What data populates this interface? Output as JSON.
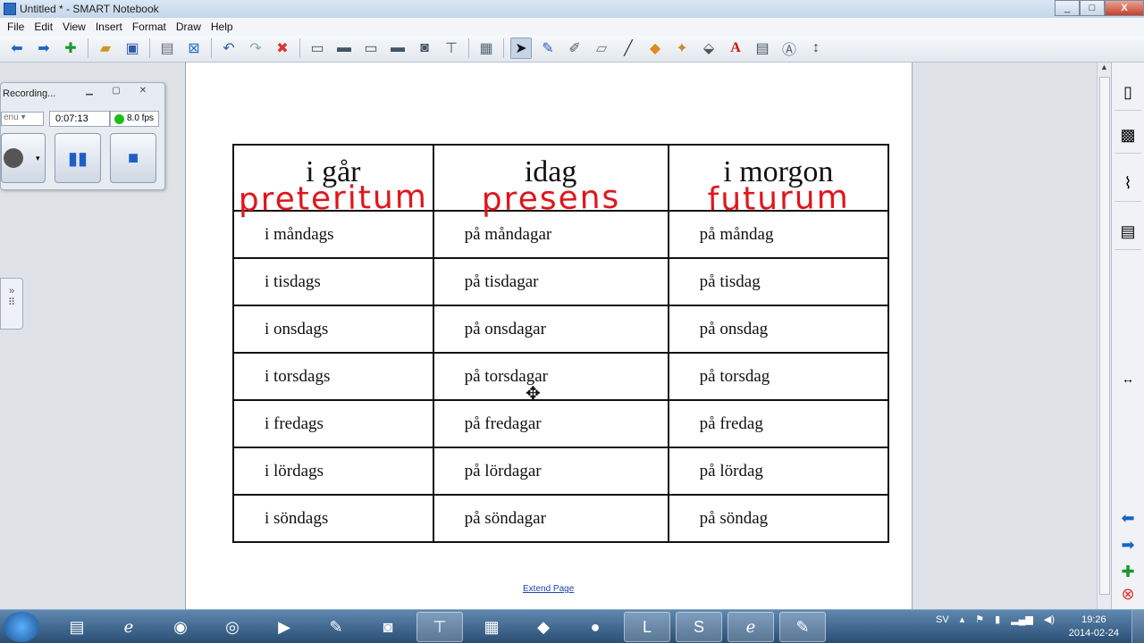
{
  "window": {
    "title": "Untitled * - SMART Notebook",
    "minimize": "_",
    "maximize": "□",
    "close": "X"
  },
  "menu": [
    "File",
    "Edit",
    "View",
    "Insert",
    "Format",
    "Draw",
    "Help"
  ],
  "toolbar": {
    "icons": [
      "back-icon",
      "forward-icon",
      "add-page-icon",
      "open-icon",
      "save-icon",
      "paste-icon",
      "delete-page-icon",
      "undo-icon",
      "redo-icon",
      "delete-icon",
      "screen-shade-icon",
      "full-screen-icon",
      "dual-display-icon",
      "transparent-background-icon",
      "screen-capture-icon",
      "document-camera-icon",
      "table-icon",
      "select-icon",
      "pen-icon",
      "creative-pen-icon",
      "eraser-icon",
      "line-icon",
      "shape-icon",
      "magic-pen-icon",
      "fill-icon",
      "text-icon",
      "properties-icon",
      "shape-recognition-icon",
      "move-toolbar-icon"
    ]
  },
  "recorder": {
    "title": "Recording...",
    "menu_label": "enu",
    "time": "0:07:13",
    "fps": "8.0 fps",
    "status_color": "#18c018"
  },
  "table": {
    "headers": [
      {
        "text": "i går",
        "ink": "preteritum"
      },
      {
        "text": "idag",
        "ink": "presens"
      },
      {
        "text": "i morgon",
        "ink": "futurum"
      }
    ],
    "rows": [
      [
        "i måndags",
        "på måndagar",
        "på måndag"
      ],
      [
        "i tisdags",
        "på tisdagar",
        "på tisdag"
      ],
      [
        "i onsdags",
        "på onsdagar",
        "på onsdag"
      ],
      [
        "i torsdags",
        "på torsdagar",
        "på torsdag"
      ],
      [
        "i fredags",
        "på fredagar",
        "på fredag"
      ],
      [
        "i lördags",
        "på lördagar",
        "på lördag"
      ],
      [
        "i söndags",
        "på söndagar",
        "på söndag"
      ]
    ],
    "ink_color": "#e0161c"
  },
  "extend_page": "Extend Page",
  "taskbar": {
    "language": "SV",
    "time": "19:26",
    "date": "2014-02-24"
  }
}
